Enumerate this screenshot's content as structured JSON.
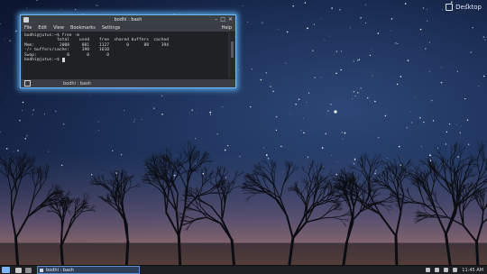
{
  "desktop": {
    "label": "Desktop"
  },
  "terminal": {
    "title": "bodhi : bash",
    "menu": [
      "File",
      "Edit",
      "View",
      "Bookmarks",
      "Settings"
    ],
    "help": "Help",
    "prompt_command": "bodhi@jutus:~$ free -m",
    "header": [
      "total",
      "used",
      "free",
      "shared",
      "buffers",
      "cached"
    ],
    "rows": [
      {
        "label": "Mem:",
        "values": [
          "2008",
          "881",
          "1127",
          "0",
          "88",
          "394"
        ]
      },
      {
        "label": "-/+ buffers/cache:",
        "values": [
          "398",
          "1610"
        ]
      },
      {
        "label": "Swap:",
        "values": [
          "0",
          "0",
          "0"
        ]
      }
    ],
    "prompt_last": "bodhi@jutus:~$ ",
    "tab_label": "bodhi : bash"
  },
  "taskbar": {
    "task_label": "bodhi : bash",
    "clock": "11:45 AM"
  }
}
